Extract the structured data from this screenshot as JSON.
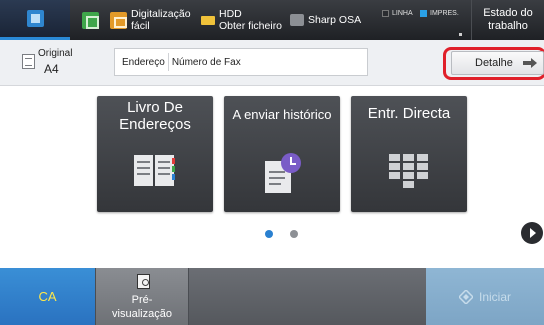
{
  "topbar": {
    "home_icon": "home-icon",
    "copy_icon": "copy-icon",
    "easy_scan": {
      "line1": "Digitalização",
      "line2": "fácil"
    },
    "hdd": {
      "line1": "HDD",
      "line2": "Obter ficheiro"
    },
    "sharp_osa": "Sharp OSA",
    "indicator_line": "LINHA",
    "indicator_print": "IMPRES.",
    "job_status": {
      "line1": "Estado do",
      "line2": "trabalho"
    }
  },
  "settings": {
    "original_label": "Original",
    "original_value": "A4",
    "address_label": "Endereço",
    "address_placeholder": "Número de Fax",
    "detail_label": "Detalhe"
  },
  "tiles": [
    {
      "line1": "Livro De",
      "line2": "Endereços",
      "icon": "address-book-icon"
    },
    {
      "label": "A enviar histórico",
      "icon": "history-icon"
    },
    {
      "label": "Entr. Directa",
      "icon": "keypad-icon"
    }
  ],
  "pagination": {
    "current": 1,
    "total": 2
  },
  "bottombar": {
    "ca_label": "CA",
    "preview": {
      "line1": "Pré-",
      "line2": "visualização"
    },
    "start_label": "Iniciar"
  },
  "colors": {
    "accent_blue": "#2a80d0",
    "highlight_red": "#e0202a",
    "ca_text": "#ffe84a"
  }
}
